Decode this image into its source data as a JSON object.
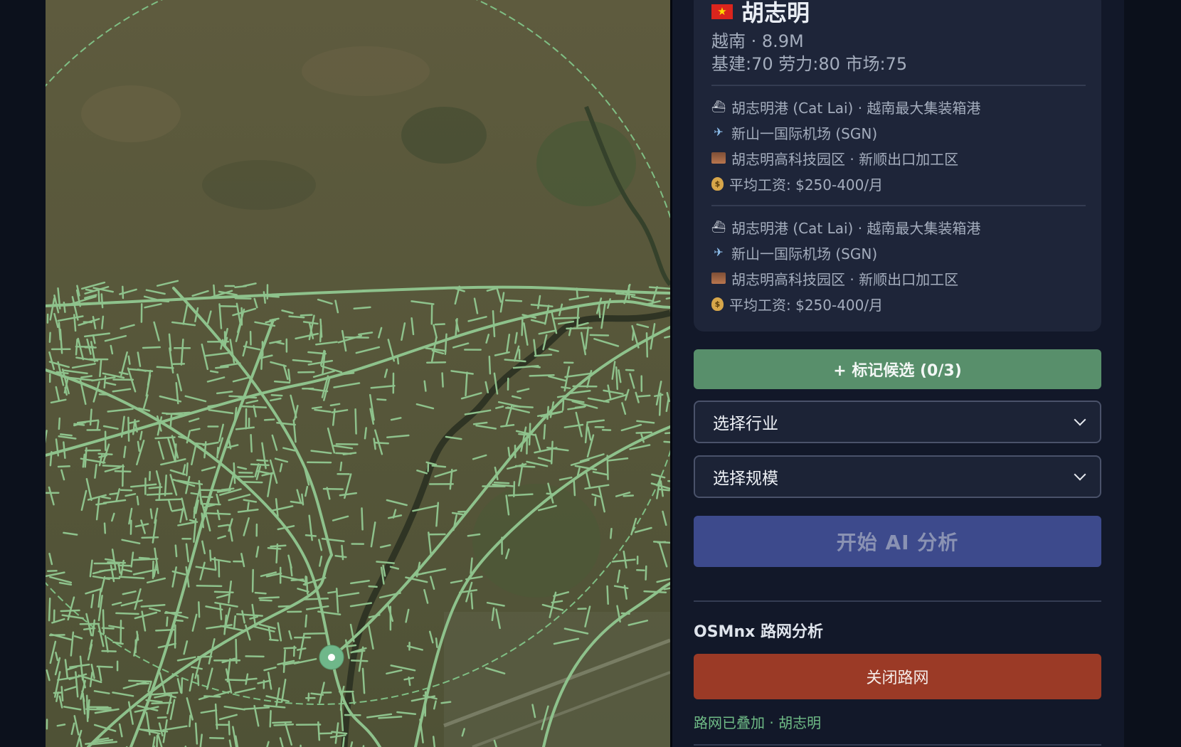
{
  "map": {
    "overlay_color": "#8ec28c",
    "marker_color": "#6fb78a"
  },
  "city": {
    "flag_icon": "vietnam-flag",
    "flag_glyph": "★",
    "name": "胡志明",
    "subtitle": "越南 · 8.9M",
    "stats": "基建:70 劳力:80 市场:75"
  },
  "info_groups": [
    [
      {
        "icon": "ship-icon",
        "text": "胡志明港 (Cat Lai) · 越南最大集装箱港"
      },
      {
        "icon": "airplane-icon",
        "text": "新山一国际机场 (SGN)"
      },
      {
        "icon": "factory-icon",
        "text": "胡志明高科技园区 · 新顺出口加工区"
      },
      {
        "icon": "money-bag-icon",
        "text": "平均工资: $250-400/月"
      }
    ],
    [
      {
        "icon": "ship-icon",
        "text": "胡志明港 (Cat Lai) · 越南最大集装箱港"
      },
      {
        "icon": "airplane-icon",
        "text": "新山一国际机场 (SGN)"
      },
      {
        "icon": "factory-icon",
        "text": "胡志明高科技园区 · 新顺出口加工区"
      },
      {
        "icon": "money-bag-icon",
        "text": "平均工资: $250-400/月"
      }
    ]
  ],
  "actions": {
    "mark_candidate": "+ 标记候选 (0/3)",
    "industry_select": "选择行业",
    "scale_select": "选择规模",
    "start_ai": "开始 AI 分析"
  },
  "osmnx": {
    "title": "OSMnx 路网分析",
    "close_button": "关闭路网",
    "status": "路网已叠加 · 胡志明"
  },
  "colors": {
    "mark_button": "#588f6b",
    "ai_button": "#3d4a8c",
    "close_button": "#9b3a26",
    "status_text": "#6fbb86"
  }
}
